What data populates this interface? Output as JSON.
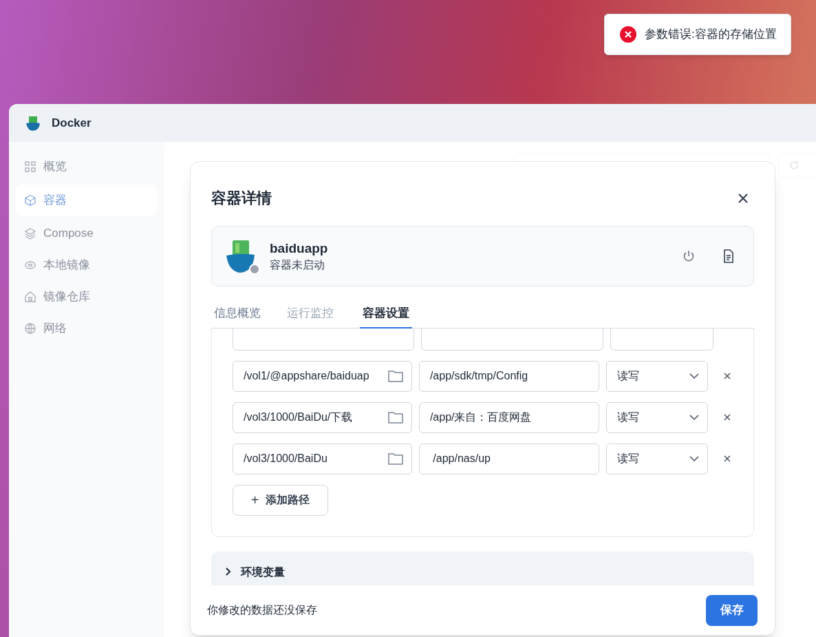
{
  "toast": {
    "kind": "error",
    "message": "参数错误:容器的存储位置"
  },
  "app": {
    "title": "Docker"
  },
  "sidebar": {
    "items": [
      {
        "label": "概览",
        "selected": false
      },
      {
        "label": "容器",
        "selected": true
      },
      {
        "label": "Compose",
        "selected": false
      },
      {
        "label": "本地镜像",
        "selected": false
      },
      {
        "label": "镜像仓库",
        "selected": false
      },
      {
        "label": "网络",
        "selected": false
      }
    ]
  },
  "dialog": {
    "title": "容器详情",
    "container": {
      "name": "baiduapp",
      "status": "容器未启动",
      "running": false
    },
    "tabs": [
      {
        "label": "信息概览",
        "selected": false
      },
      {
        "label": "运行监控",
        "selected": false
      },
      {
        "label": "容器设置",
        "selected": true
      }
    ],
    "volumes": [
      {
        "host_path": "/vol1/@appshare/baiduap",
        "container_path": "/app/sdk/tmp/Config",
        "mode": "读写"
      },
      {
        "host_path": "/vol3/1000/BaiDu/下载",
        "container_path": "/app/来自：百度网盘",
        "mode": "读写"
      },
      {
        "host_path": "/vol3/1000/BaiDu",
        "container_path": " /app/nas/up",
        "mode": "读写"
      }
    ],
    "add_path_button": {
      "icon": "+",
      "label": "添加路径"
    },
    "env_section": {
      "label": "环境变量",
      "expanded": false
    },
    "footer": {
      "message": "你修改的数据还没保存",
      "save_button": "保存"
    }
  }
}
